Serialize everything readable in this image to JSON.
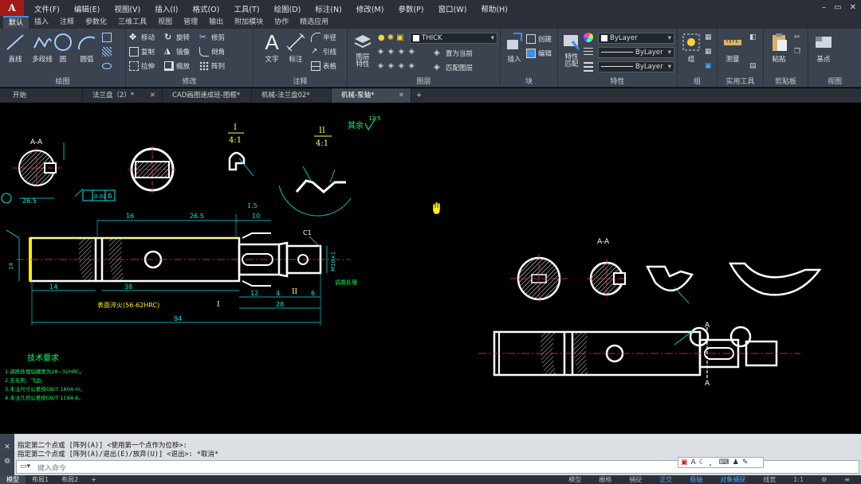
{
  "menu": [
    "文件(F)",
    "编辑(E)",
    "视图(V)",
    "插入(I)",
    "格式(O)",
    "工具(T)",
    "绘图(D)",
    "标注(N)",
    "修改(M)",
    "参数(P)",
    "窗口(W)",
    "帮助(H)"
  ],
  "window_controls": [
    "–",
    "▭",
    "✕"
  ],
  "ribbon_tabs": [
    "默认",
    "插入",
    "注释",
    "参数化",
    "三维工具",
    "视图",
    "管理",
    "输出",
    "附加模块",
    "协作",
    "精选应用"
  ],
  "ribbon": {
    "draw": {
      "label": "绘图",
      "tools": [
        "直线",
        "多段线",
        "圆",
        "圆弧"
      ]
    },
    "modify": {
      "label": "修改",
      "rows": [
        [
          "移动",
          "旋转",
          "修剪"
        ],
        [
          "复制",
          "镜像",
          "倒角"
        ],
        [
          "拉伸",
          "缩放",
          "阵列"
        ]
      ]
    },
    "annotation": {
      "label": "注释",
      "big": [
        "文字",
        "标注"
      ],
      "small": [
        "半径",
        "引线",
        "表格"
      ]
    },
    "layers": {
      "label": "图层",
      "big": "图层\n特性",
      "layer_name": "THICK",
      "small": [
        "置为当前",
        "匹配图层"
      ]
    },
    "block": {
      "label": "块",
      "big": "插入",
      "small": [
        "创建",
        "编辑"
      ]
    },
    "properties": {
      "label": "特性",
      "big": "特性\n匹配",
      "values": [
        "ByLayer",
        "ByLayer",
        "ByLayer"
      ]
    },
    "groups": {
      "label": "组",
      "big": "组"
    },
    "utilities": {
      "label": "实用工具",
      "big": "测量"
    },
    "clipboard": {
      "label": "剪贴板",
      "big": "粘贴"
    },
    "view": {
      "label": "视图",
      "big": "基点"
    }
  },
  "doc_tabs": [
    {
      "name": "开始",
      "active": false
    },
    {
      "name": "法兰盘（2）*",
      "active": false
    },
    {
      "name": "CAD画图速成班-图框*",
      "active": false
    },
    {
      "name": "机械-法兰盘02*",
      "active": false
    },
    {
      "name": "机械-泵轴*",
      "active": true
    }
  ],
  "drawing_text": {
    "section_aa": "A-A",
    "detail_i": "I",
    "detail_ii": "II",
    "scale": "4:1",
    "rest": "其余",
    "roughness": "12.5",
    "tol_1": "0.02",
    "tol_b": "B",
    "dim_16": "16",
    "dim_265": "26.5",
    "dim_10": "10",
    "dim_15": "1.5",
    "dim_14": "14",
    "dim_38": "38",
    "dim_12": "12",
    "dim_4": "4",
    "dim_6": "6",
    "dim_28": "28",
    "dim_94": "94",
    "c1": "C1",
    "m10": "M10×1",
    "surface_note": "表面淬火(56-62HRC)",
    "cut_note": "调质处理",
    "tech_title": "技术要求",
    "tech_lines": [
      "1.调质处理后硬度为28~32HRC。",
      "2.去毛刺、飞边。",
      "3.未注尺寸公差按GB/T 1804-m。",
      "4.未注几何公差按GB/T 1184-K。"
    ],
    "section_a": "A-A",
    "cut_a": "A"
  },
  "command_lines": [
    "指定第二个点或 [阵列(A)] <使用第一个点作为位移>:",
    "指定第二个点或 [阵列(A)/退出(E)/放弃(U)] <退出>: *取消*"
  ],
  "command_prompt": "键入命令",
  "status_tabs": [
    "模型",
    "布局1",
    "布局2"
  ],
  "status_right": [
    "模型",
    "栅格",
    "捕捉",
    "正交",
    "极轴",
    "对象捕捉",
    "线宽",
    "1:1"
  ]
}
